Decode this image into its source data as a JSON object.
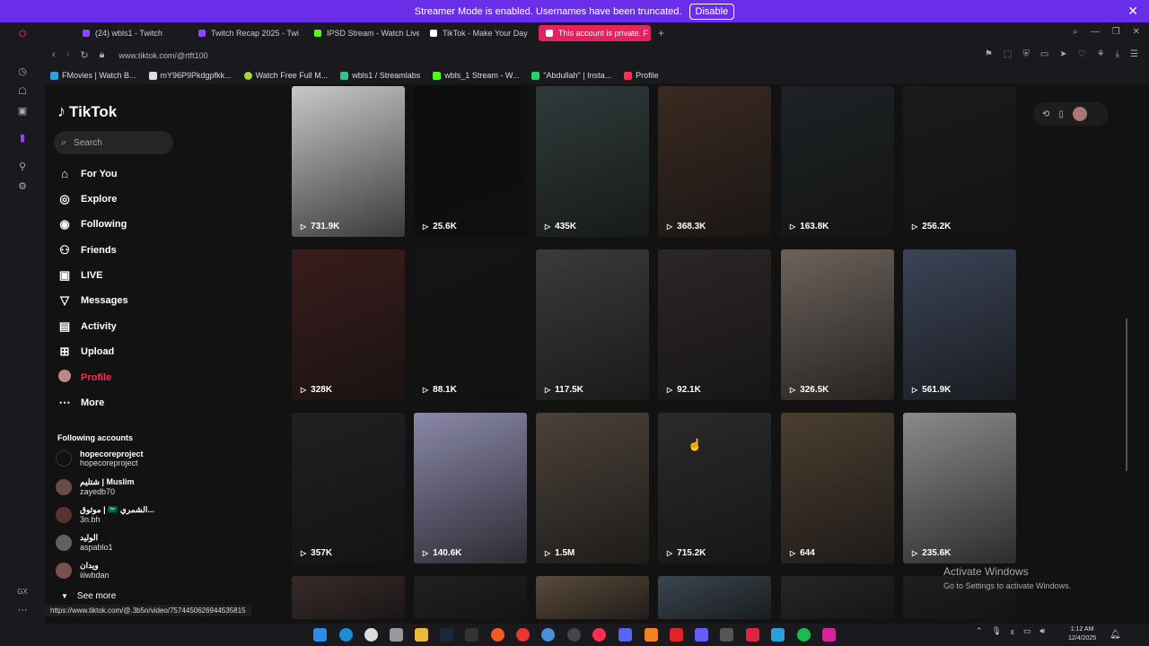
{
  "banner": {
    "text": "Streamer Mode is enabled. Usernames have been truncated.",
    "button": "Disable"
  },
  "tabs": [
    {
      "label": "(24) wbls1 - Twitch",
      "color": "#9146ff"
    },
    {
      "label": "Twitch Recap 2025 - Twi",
      "color": "#9146ff"
    },
    {
      "label": "IPSD Stream - Watch Live",
      "color": "#53fc18"
    },
    {
      "label": "TikTok - Make Your Day",
      "color": "#ffffff"
    },
    {
      "label": "This account is private. F",
      "color": "#ffffff"
    }
  ],
  "address": {
    "url": "www.tiktok.com/@rtft100"
  },
  "bookmarks": [
    {
      "label": "FMovies | Watch B...",
      "color": "#2aa3e0"
    },
    {
      "label": "mY96P9Pkdgpfkk...",
      "color": "#dddddd"
    },
    {
      "label": "Watch Free Full M...",
      "color": "#a5d63a"
    },
    {
      "label": "wbls1 / Streamlabs",
      "color": "#31c48d"
    },
    {
      "label": "wbls_1 Stream - W...",
      "color": "#53fc18"
    },
    {
      "label": "\"Abdullah\" | Insta...",
      "color": "#25d366"
    },
    {
      "label": "Profile",
      "color": "#fe2c55"
    }
  ],
  "sidebar": {
    "logo": "TikTok",
    "search_placeholder": "Search",
    "nav": [
      {
        "label": "For You",
        "icon": "home-icon",
        "glyph": "⌂"
      },
      {
        "label": "Explore",
        "icon": "compass-icon",
        "glyph": "◎"
      },
      {
        "label": "Following",
        "icon": "following-icon",
        "glyph": "◉"
      },
      {
        "label": "Friends",
        "icon": "friends-icon",
        "glyph": "⚇"
      },
      {
        "label": "LIVE",
        "icon": "live-icon",
        "glyph": "▣"
      },
      {
        "label": "Messages",
        "icon": "messages-icon",
        "glyph": "▽"
      },
      {
        "label": "Activity",
        "icon": "activity-icon",
        "glyph": "▤"
      },
      {
        "label": "Upload",
        "icon": "upload-icon",
        "glyph": "⊞"
      },
      {
        "label": "Profile",
        "icon": "profile-icon",
        "glyph": "●"
      },
      {
        "label": "More",
        "icon": "more-icon",
        "glyph": "⋯"
      }
    ],
    "following_heading": "Following accounts",
    "accounts": [
      {
        "name": "hopecoreproject",
        "user": "hopecoreproject"
      },
      {
        "name": "شتليم | Muslim",
        "user": "zayedb70"
      },
      {
        "name": "موثوق | 🇸🇦 الشمري...",
        "user": "3n.bh"
      },
      {
        "name": "الوليد",
        "user": "aspablo1"
      },
      {
        "name": "ويدان",
        "user": "iiiwbdan"
      }
    ],
    "see_more": "See more"
  },
  "status_url": "https://www.tiktok.com/@.3b5n/video/7574450626944535815",
  "videos": [
    {
      "views": "731.9K",
      "color": "#c8c8c8"
    },
    {
      "views": "25.6K",
      "color": "#0d0d0d"
    },
    {
      "views": "435K",
      "color": "#2f3a3a"
    },
    {
      "views": "368.3K",
      "color": "#3a2a20"
    },
    {
      "views": "163.8K",
      "color": "#1e2224"
    },
    {
      "views": "256.2K",
      "color": "#1b1b1b"
    },
    {
      "views": "328K",
      "color": "#3a1c1c"
    },
    {
      "views": "88.1K",
      "color": "#141414"
    },
    {
      "views": "117.5K",
      "color": "#3a3a38"
    },
    {
      "views": "92.1K",
      "color": "#2c2626"
    },
    {
      "views": "326.5K",
      "color": "#6b625a"
    },
    {
      "views": "561.9K",
      "color": "#3a4456"
    },
    {
      "views": "357K",
      "color": "#1f2022"
    },
    {
      "views": "140.6K",
      "color": "#8a88a8"
    },
    {
      "views": "1.5M",
      "color": "#4a4238"
    },
    {
      "views": "715.2K",
      "color": "#2a2a2a"
    },
    {
      "views": "644",
      "color": "#4a3e30"
    },
    {
      "views": "235.6K",
      "color": "#8a8a8a"
    },
    {
      "views": "",
      "color": "#3a2a2a"
    },
    {
      "views": "",
      "color": "#202020"
    },
    {
      "views": "",
      "color": "#5a4a3a"
    },
    {
      "views": "",
      "color": "#3a4650"
    },
    {
      "views": "",
      "color": "#262626"
    },
    {
      "views": "",
      "color": "#1e1e1e"
    }
  ],
  "activate": {
    "title": "Activate Windows",
    "sub": "Go to Settings to activate Windows."
  },
  "clock": {
    "time": "1:12 AM",
    "date": "12/4/2025"
  }
}
